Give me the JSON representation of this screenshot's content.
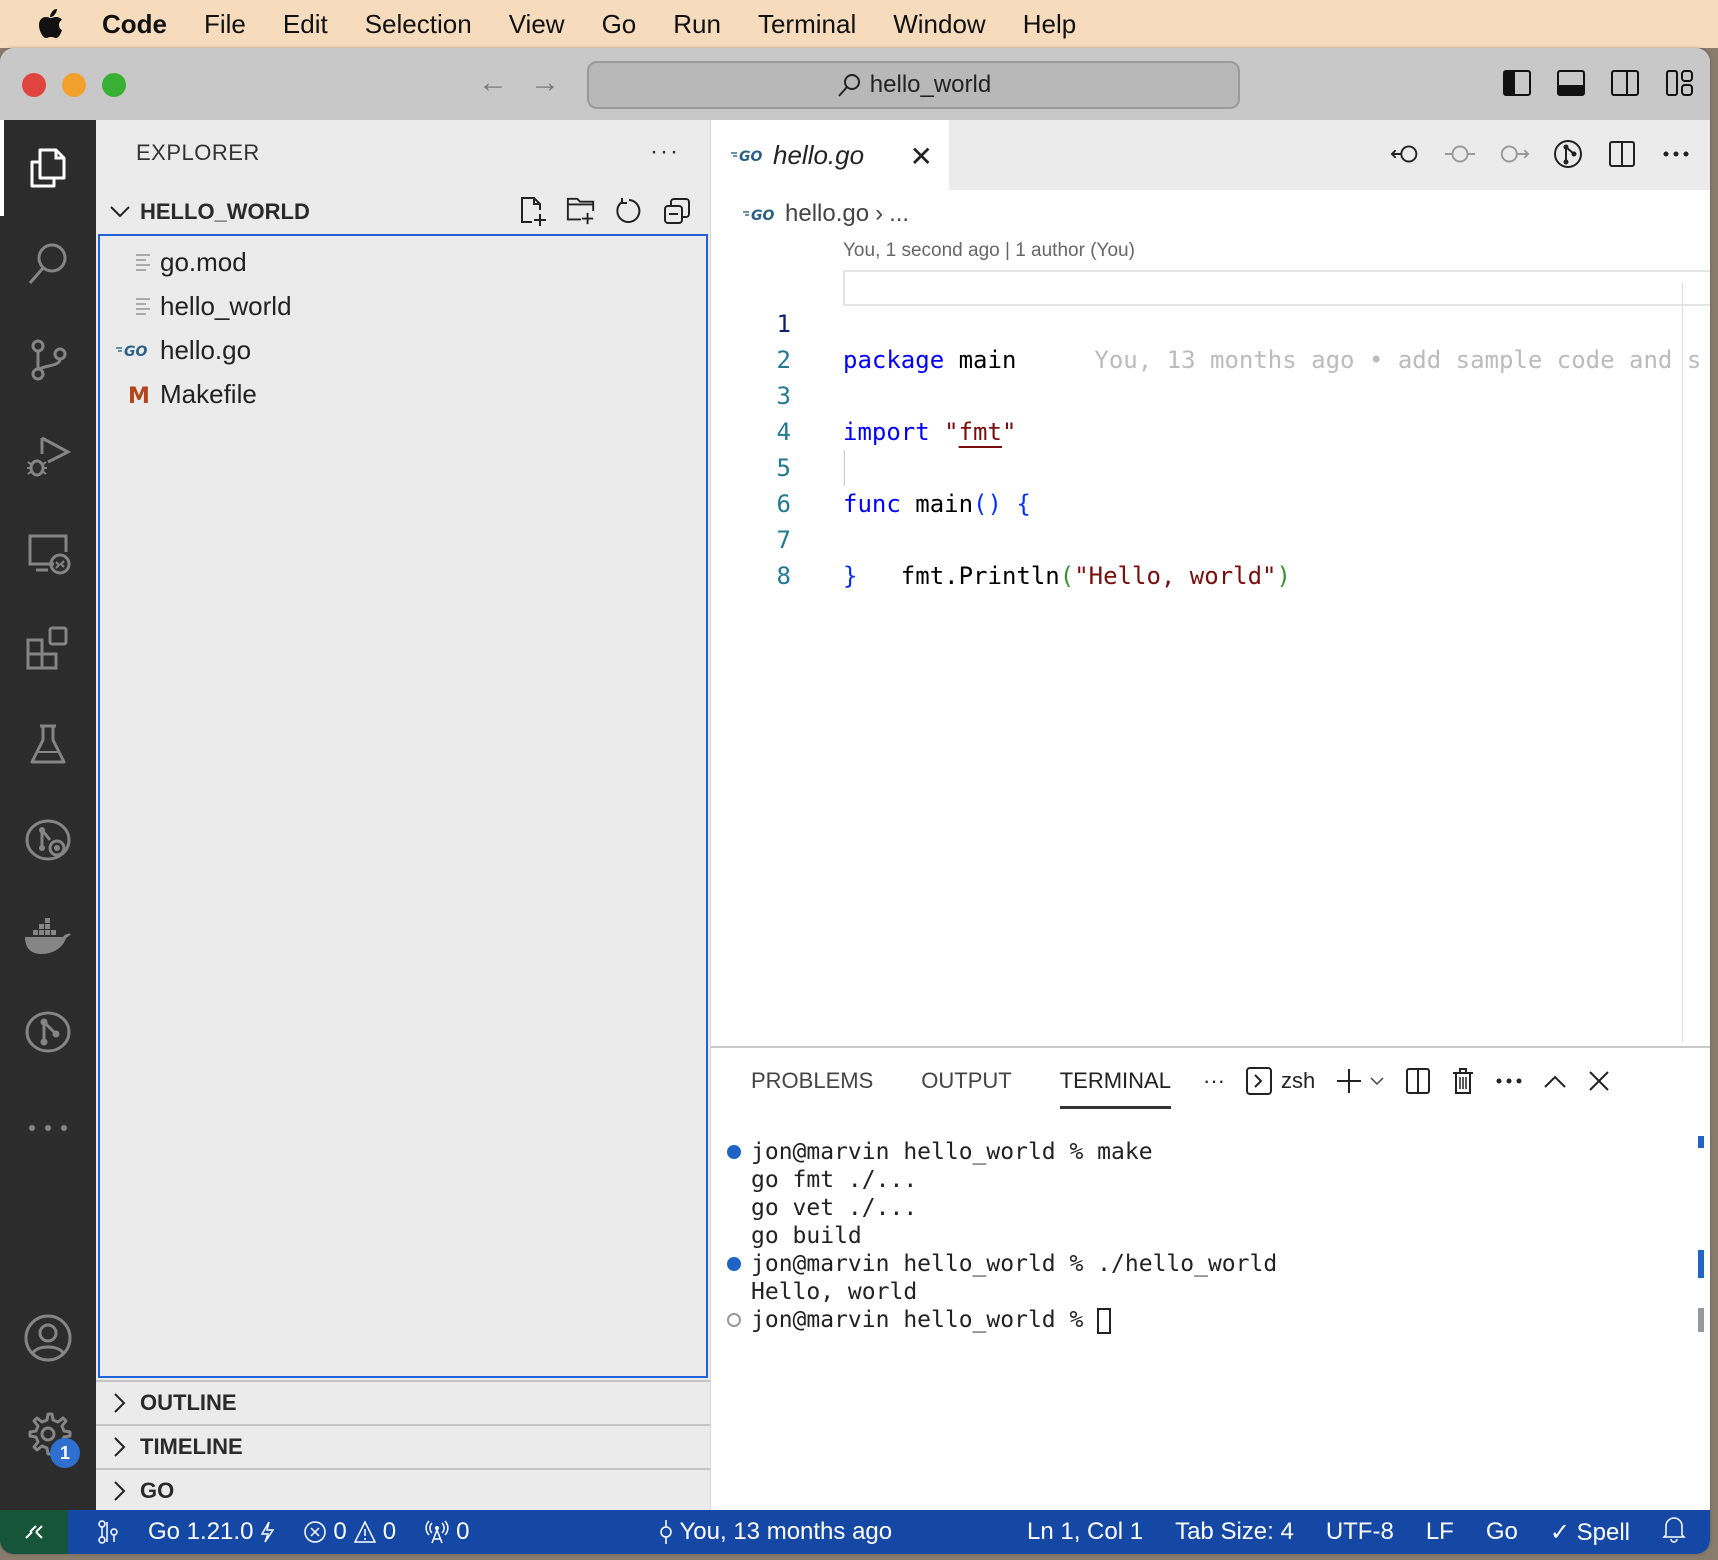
{
  "menubar": {
    "app_name": "Code",
    "items": [
      "File",
      "Edit",
      "Selection",
      "View",
      "Go",
      "Run",
      "Terminal",
      "Window",
      "Help"
    ]
  },
  "titlebar": {
    "search_text": "hello_world"
  },
  "activitybar": {
    "items": [
      "explorer",
      "search",
      "source-control",
      "run-and-debug",
      "remote-explorer",
      "extensions",
      "testing",
      "gitlens-inspect",
      "docker",
      "gitlens",
      "more"
    ],
    "settings_badge": "1"
  },
  "sidebar": {
    "title": "EXPLORER",
    "more": "···",
    "folder": "HELLO_WORLD",
    "files": [
      {
        "name": "go.mod",
        "icon": "lines-icon"
      },
      {
        "name": "hello_world",
        "icon": "lines-icon"
      },
      {
        "name": "hello.go",
        "icon": "go-icon"
      },
      {
        "name": "Makefile",
        "icon": "makefile-icon"
      }
    ],
    "sections": [
      "OUTLINE",
      "TIMELINE",
      "GO"
    ]
  },
  "editor": {
    "tab": {
      "label": "hello.go",
      "close": "✕"
    },
    "breadcrumb": {
      "file": "hello.go",
      "sep": "›",
      "rest": "..."
    },
    "codelens": "You, 1 second ago | 1 author (You)",
    "blame": "You, 13 months ago • add sample code and s",
    "line_numbers": [
      "1",
      "2",
      "3",
      "4",
      "5",
      "6",
      "7",
      "8"
    ],
    "code": {
      "l1_kw": "package",
      "l1_rest": " main",
      "l3_kw": "import",
      "l3_q1": " \"",
      "l3_str": "fmt",
      "l3_q2": "\"",
      "l5_kw": "func",
      "l5_name": " main",
      "l5_paren": "()",
      "l5_brace": " {",
      "l6_call": "    fmt.Println",
      "l6_open": "(",
      "l6_str": "\"Hello, world\"",
      "l6_close": ")",
      "l7": "}"
    }
  },
  "panel": {
    "tabs": [
      "PROBLEMS",
      "OUTPUT",
      "TERMINAL"
    ],
    "active_tab": "TERMINAL",
    "more": "···",
    "shell": "zsh",
    "terminal_lines": [
      {
        "marker": "success",
        "text": "jon@marvin hello_world % make"
      },
      {
        "marker": "none",
        "text": "go fmt ./..."
      },
      {
        "marker": "none",
        "text": "go vet ./..."
      },
      {
        "marker": "none",
        "text": "go build"
      },
      {
        "marker": "success",
        "text": "jon@marvin hello_world % ./hello_world"
      },
      {
        "marker": "none",
        "text": "Hello, world"
      },
      {
        "marker": "pending",
        "text": "jon@marvin hello_world % "
      }
    ]
  },
  "statusbar": {
    "go_version": "Go 1.21.0",
    "errors": "0",
    "warnings": "0",
    "ports": "0",
    "blame": "You, 13 months ago",
    "position": "Ln 1, Col 1",
    "tab_size": "Tab Size: 4",
    "encoding": "UTF-8",
    "eol": "LF",
    "language": "Go",
    "spell": "✓ Spell"
  },
  "colors": {
    "accent": "#1f63d6",
    "statusbar": "#1448a4",
    "remote": "#16553a",
    "keyword": "#0000ff",
    "string": "#7a0e0e"
  }
}
